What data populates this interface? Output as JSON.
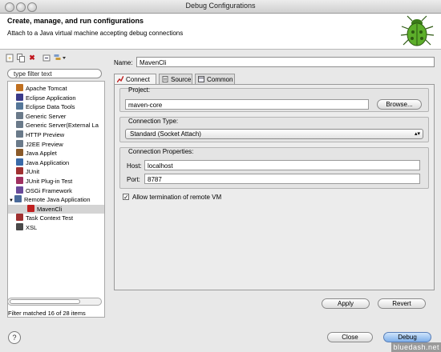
{
  "window": {
    "title": "Debug Configurations"
  },
  "header": {
    "title": "Create, manage, and run configurations",
    "subtitle": "Attach to a Java virtual machine accepting debug connections"
  },
  "sidebar": {
    "filter_placeholder": "type filter text",
    "items": [
      {
        "label": "Apache Tomcat",
        "icon": "tomcat-icon"
      },
      {
        "label": "Eclipse Application",
        "icon": "eclipse-icon"
      },
      {
        "label": "Eclipse Data Tools",
        "icon": "data-tools-icon"
      },
      {
        "label": "Generic Server",
        "icon": "server-icon"
      },
      {
        "label": "Generic Server(External La",
        "icon": "server-icon"
      },
      {
        "label": "HTTP Preview",
        "icon": "server-icon"
      },
      {
        "label": "J2EE Preview",
        "icon": "server-icon"
      },
      {
        "label": "Java Applet",
        "icon": "applet-icon"
      },
      {
        "label": "Java Application",
        "icon": "java-app-icon"
      },
      {
        "label": "JUnit",
        "icon": "junit-icon"
      },
      {
        "label": "JUnit Plug-in Test",
        "icon": "junit-plugin-icon"
      },
      {
        "label": "OSGi Framework",
        "icon": "osgi-icon"
      },
      {
        "label": "Remote Java Application",
        "icon": "remote-java-icon"
      },
      {
        "label": "MavenCli",
        "icon": "config-icon"
      },
      {
        "label": "Task Context Test",
        "icon": "junit-icon"
      },
      {
        "label": "XSL",
        "icon": "xsl-icon"
      }
    ],
    "status": "Filter matched 16 of 28 items"
  },
  "form": {
    "name_label": "Name:",
    "name_value": "MavenCli",
    "tabs": [
      {
        "label": "Connect",
        "icon": "connect-icon"
      },
      {
        "label": "Source",
        "icon": "source-icon"
      },
      {
        "label": "Common",
        "icon": "common-icon"
      }
    ],
    "project": {
      "title": "Project:",
      "value": "maven-core",
      "browse": "Browse..."
    },
    "connection_type": {
      "title": "Connection Type:",
      "value": "Standard (Socket Attach)"
    },
    "connection_props": {
      "title": "Connection Properties:",
      "host_label": "Host:",
      "host_value": "localhost",
      "port_label": "Port:",
      "port_value": "8787"
    },
    "allow_termination": {
      "label": "Allow termination of remote VM",
      "checked": true
    },
    "apply": "Apply",
    "revert": "Revert"
  },
  "footer": {
    "close": "Close",
    "debug": "Debug",
    "help_glyph": "?"
  },
  "watermark": "bluedash.net"
}
